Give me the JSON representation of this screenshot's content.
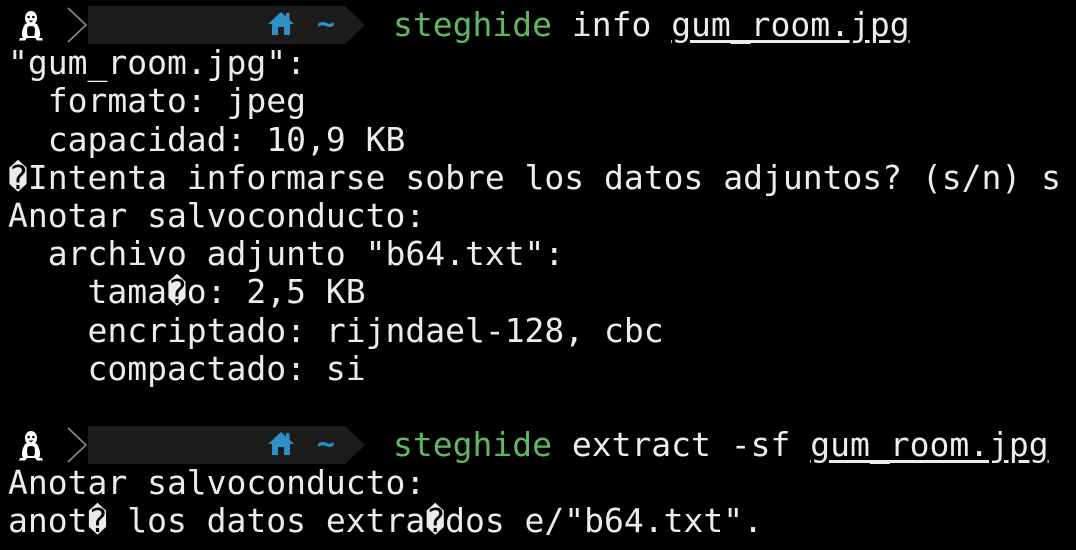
{
  "prompt": {
    "os_icon": "linux-tux-icon",
    "separator_icon": "chevron-right-icon",
    "home_icon": "home-icon",
    "directory": "~",
    "colors": {
      "command": "#5fb85f",
      "home_icon": "#2f8fc7",
      "dir_segment_bg": "#1c1c1c",
      "text": "#ececec",
      "background": "#000000"
    }
  },
  "block1": {
    "command": "steghide",
    "args": " info ",
    "file": "gum_room.jpg",
    "output": [
      "\"gum_room.jpg\":",
      "  formato: jpeg",
      "  capacidad: 10,9 KB",
      "�Intenta informarse sobre los datos adjuntos? (s/n) s",
      "Anotar salvoconducto:",
      "  archivo adjunto \"b64.txt\":",
      "    tama�o: 2,5 KB",
      "    encriptado: rijndael-128, cbc",
      "    compactado: si"
    ]
  },
  "block2": {
    "command": "steghide",
    "args": " extract -sf ",
    "file": "gum_room.jpg",
    "output": [
      "Anotar salvoconducto:",
      "anot� los datos extra�dos e/\"b64.txt\"."
    ]
  }
}
